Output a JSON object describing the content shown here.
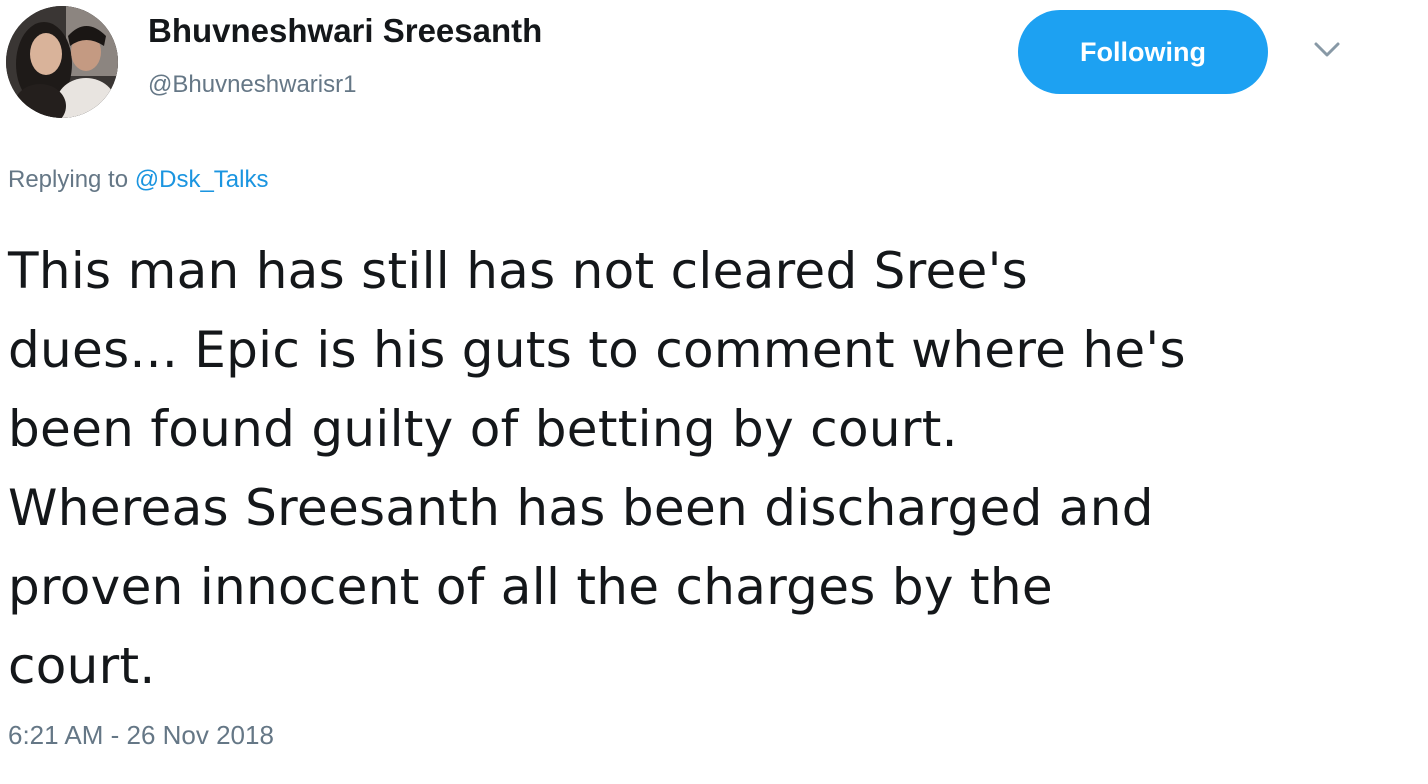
{
  "author": {
    "display_name": "Bhuvneshwari Sreesanth",
    "handle": "@Bhuvneshwarisr1",
    "avatar_icon": "profile-photo"
  },
  "follow_button": {
    "label": "Following",
    "color": "#1da1f2"
  },
  "menu": {
    "icon": "chevron-down-icon"
  },
  "reply": {
    "prefix": "Replying to",
    "mention": "@Dsk_Talks",
    "mention_color": "#1b95e0"
  },
  "tweet": {
    "lines": [
      "This man has still has not cleared Sree's",
      "dues... Epic is his guts to comment where he's",
      "been found guilty of betting by court.",
      "Whereas Sreesanth has been discharged and",
      "proven innocent of all the charges by the",
      "court."
    ],
    "timestamp": "6:21 AM - 26 Nov 2018"
  }
}
